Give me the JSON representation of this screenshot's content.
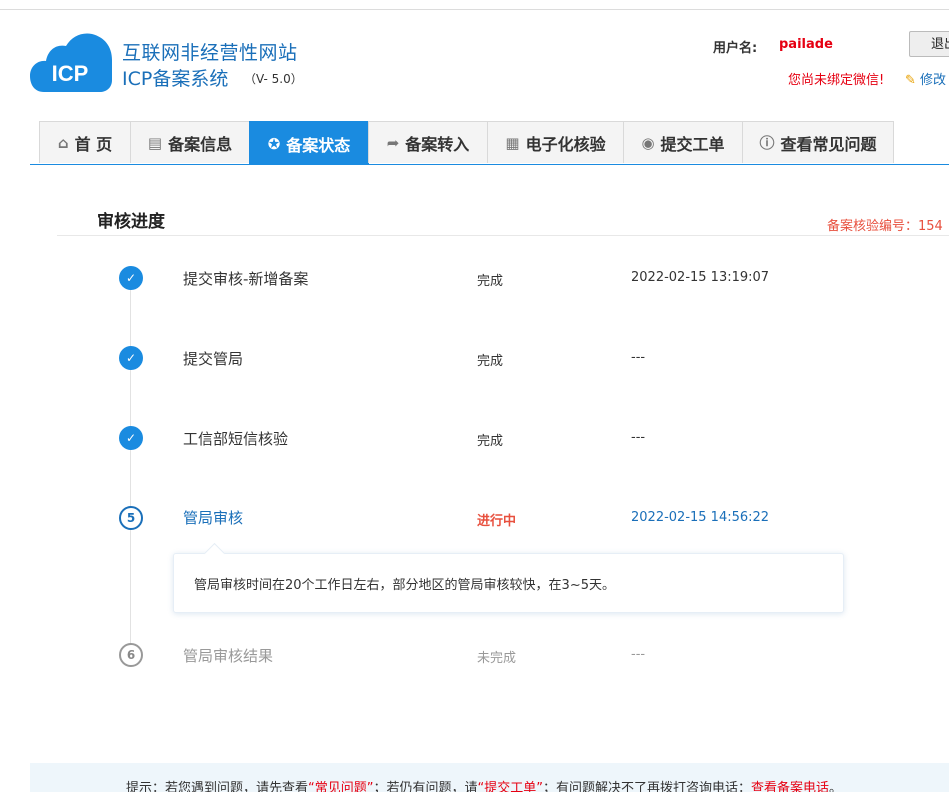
{
  "header": {
    "logo_badge": "ICP",
    "title_line1": "互联网非经营性网站",
    "title_line2": "ICP备案系统",
    "version": "（V- 5.0）",
    "user_label": "用户名:",
    "username": "pailade",
    "logout_label": "退出",
    "wechat_warning": "您尚未绑定微信!",
    "edit_label": "修改"
  },
  "nav": {
    "items": [
      {
        "label": "首 页",
        "icon": "home-icon"
      },
      {
        "label": "备案信息",
        "icon": "document-icon"
      },
      {
        "label": "备案状态",
        "icon": "lifebuoy-icon",
        "active": true
      },
      {
        "label": "备案转入",
        "icon": "share-arrow-icon"
      },
      {
        "label": "电子化核验",
        "icon": "clipboard-icon"
      },
      {
        "label": "提交工单",
        "icon": "user-icon"
      },
      {
        "label": "查看常见问题",
        "icon": "question-icon"
      }
    ]
  },
  "section": {
    "title": "审核进度",
    "verify_label": "备案核验编号：154"
  },
  "steps": [
    {
      "marker": "✓",
      "name": "提交审核-新增备案",
      "status": "完成",
      "time": "2022-02-15 13:19:07",
      "state": "done"
    },
    {
      "marker": "✓",
      "name": "提交管局",
      "status": "完成",
      "time": "---",
      "state": "done"
    },
    {
      "marker": "✓",
      "name": "工信部短信核验",
      "status": "完成",
      "time": "---",
      "state": "done"
    },
    {
      "marker": "5",
      "name": "管局审核",
      "status": "进行中",
      "time": "2022-02-15 14:56:22",
      "state": "current"
    },
    {
      "marker": "6",
      "name": "管局审核结果",
      "status": "未完成",
      "time": "---",
      "state": "todo"
    }
  ],
  "tip": {
    "text": "管局审核时间在20个工作日左右，部分地区的管局审核较快，在3~5天。"
  },
  "footer": {
    "prefix": "提示：若您遇到问题，请先查看",
    "faq_link": "“常见问题”",
    "middle": "；若仍有问题，请",
    "ticket_link": "“提交工单”",
    "after_ticket": "；有问题解决不了再拨打咨询电话：",
    "phone_link": "查看备案电话",
    "end": "。"
  },
  "colors": {
    "accent": "#1a8be0",
    "title_blue": "#1a6fb9",
    "alert_red": "#e60012",
    "status_red": "#e8503e"
  }
}
